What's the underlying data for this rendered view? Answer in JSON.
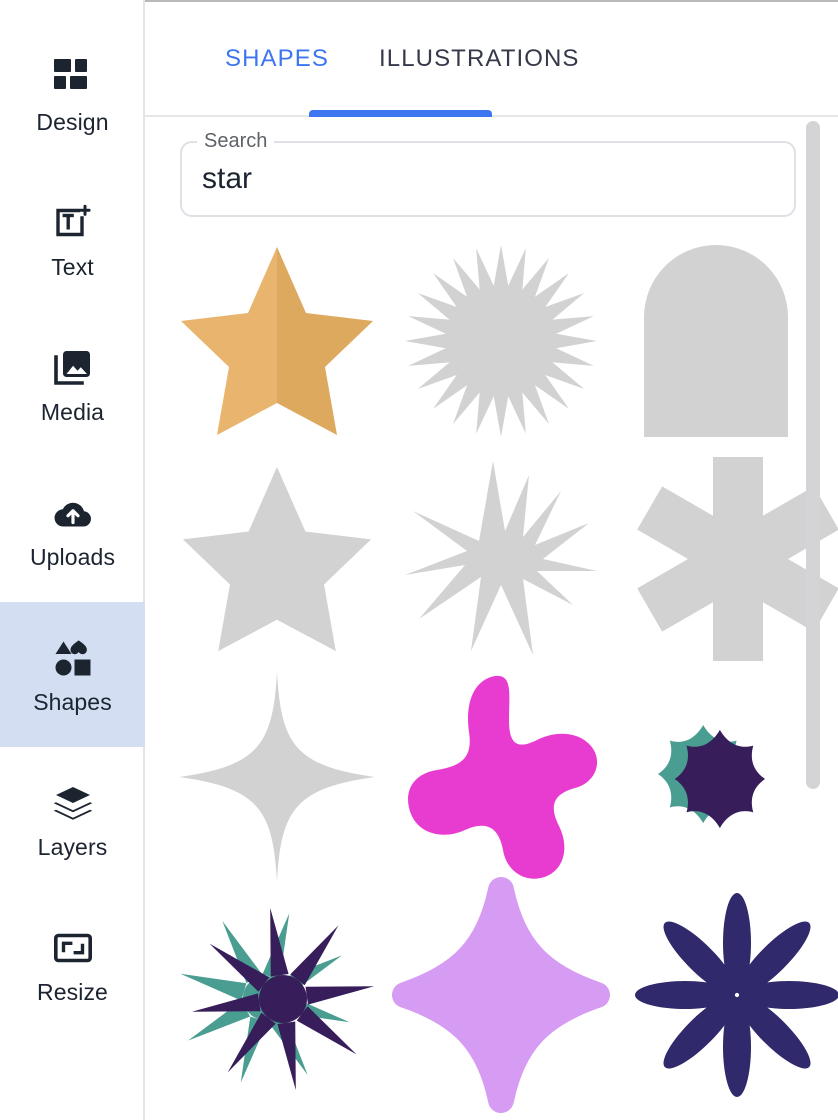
{
  "sidebar": {
    "items": [
      {
        "label": "Design",
        "icon": "design-grid-icon",
        "active": false
      },
      {
        "label": "Text",
        "icon": "text-add-icon",
        "active": false
      },
      {
        "label": "Media",
        "icon": "media-image-icon",
        "active": false
      },
      {
        "label": "Uploads",
        "icon": "cloud-upload-icon",
        "active": false
      },
      {
        "label": "Shapes",
        "icon": "shapes-icon",
        "active": true
      },
      {
        "label": "Layers",
        "icon": "layers-stack-icon",
        "active": false
      },
      {
        "label": "Resize",
        "icon": "resize-frame-icon",
        "active": false
      }
    ],
    "active_highlight_color": "#d3def2"
  },
  "tabs": {
    "items": [
      {
        "label": "SHAPES",
        "active": true
      },
      {
        "label": "ILLUSTRATIONS",
        "active": false
      }
    ],
    "active_color": "#3d76f0",
    "inactive_color": "#35394a"
  },
  "search": {
    "label": "Search",
    "value": "star",
    "placeholder": "Search"
  },
  "results": {
    "columns": 3,
    "items": [
      {
        "name": "gold-five-point-star",
        "shape": "star5-folded",
        "colors": [
          "#e9b46d",
          "#dca95f"
        ]
      },
      {
        "name": "grey-spiked-starburst",
        "shape": "starburst-24",
        "colors": [
          "#d2d2d2"
        ]
      },
      {
        "name": "grey-arch-tombstone",
        "shape": "arch",
        "colors": [
          "#d2d2d2"
        ]
      },
      {
        "name": "grey-five-point-star",
        "shape": "star5",
        "colors": [
          "#d2d2d2"
        ]
      },
      {
        "name": "grey-explosion-star",
        "shape": "explosion",
        "colors": [
          "#d2d2d2"
        ]
      },
      {
        "name": "grey-six-point-asterisk",
        "shape": "asterisk6",
        "colors": [
          "#d2d2d2"
        ]
      },
      {
        "name": "grey-four-point-sparkle",
        "shape": "sparkle4",
        "colors": [
          "#d2d2d2"
        ]
      },
      {
        "name": "magenta-blob-star",
        "shape": "blob-star5",
        "colors": [
          "#e83bd0"
        ]
      },
      {
        "name": "purple-teal-spiky-badge",
        "shape": "spiky-badge",
        "colors": [
          "#371d59",
          "#4a9e91"
        ]
      },
      {
        "name": "purple-teal-spiky-star",
        "shape": "spiky-star",
        "colors": [
          "#371d59",
          "#4a9e91"
        ]
      },
      {
        "name": "violet-four-point-star",
        "shape": "soft-star4",
        "colors": [
          "#d69bf2"
        ]
      },
      {
        "name": "navy-eight-point-star",
        "shape": "star8-needle",
        "colors": [
          "#30296b"
        ]
      }
    ]
  },
  "scrollbar": {
    "name": "results-scrollbar",
    "thumb_color": "#d4d4d6"
  }
}
